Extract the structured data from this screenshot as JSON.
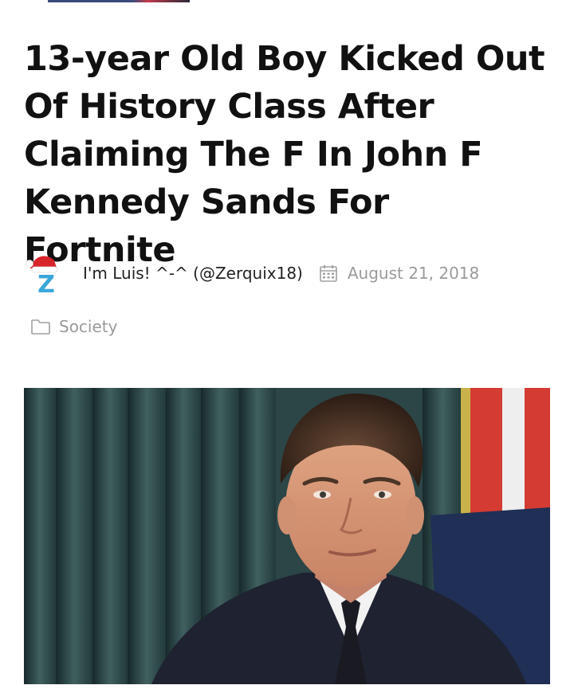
{
  "article": {
    "title": "13-year Old Boy Kicked Out Of History Class After Claiming The F In John F Kennedy Sands For Fortnite",
    "author": "I'm Luis! ^-^ (@Zerquix18)",
    "date": "August 21, 2018",
    "category": "Society",
    "avatar_letter": "Z"
  },
  "icons": {
    "calendar": "calendar-icon",
    "folder": "folder-icon",
    "avatar": "santa-hat-z-avatar"
  },
  "colors": {
    "title": "#111111",
    "meta_muted": "#9a9a9a",
    "avatar_letter": "#3aa6d9",
    "hat_red": "#d8242b"
  }
}
